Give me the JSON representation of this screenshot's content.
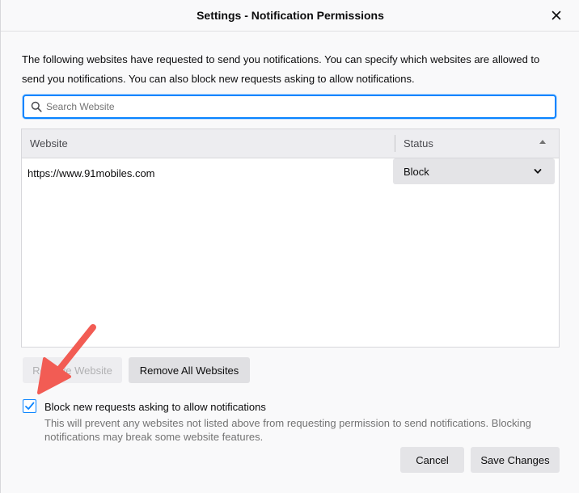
{
  "window": {
    "title": "Settings - Notification Permissions",
    "close_symbol": "✕"
  },
  "description": "The following websites have requested to send you notifications. You can specify which websites are allowed to send you notifications. You can also block new requests asking to allow notifications.",
  "search": {
    "placeholder": "Search Website",
    "value": "",
    "icon": "search-icon"
  },
  "table": {
    "columns": {
      "website": "Website",
      "status": "Status"
    },
    "sort": "status-ascending",
    "rows": [
      {
        "website": "https://www.91mobiles.com",
        "status": "Block"
      }
    ]
  },
  "buttons": {
    "remove_website": "Remove Website",
    "remove_all_websites": "Remove All Websites",
    "cancel": "Cancel",
    "save_changes": "Save Changes"
  },
  "block_new_requests": {
    "checked": true,
    "label": "Block new requests asking to allow notifications",
    "help": "This will prevent any websites not listed above from requesting permission to send notifications. Blocking notifications may break some website features."
  },
  "colors": {
    "accent": "#0a84ff",
    "annotation_arrow": "#f25c54"
  }
}
